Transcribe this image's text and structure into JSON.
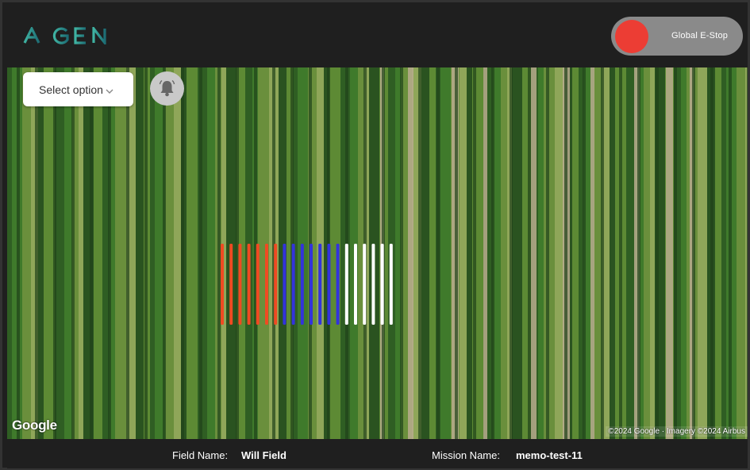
{
  "header": {
    "logo_text": "AIGEN",
    "estop_label": "Global E-Stop",
    "estop_color": "#ec3d34"
  },
  "map": {
    "select": {
      "label": "Select option",
      "icon": "chevron-down-icon"
    },
    "alerts_icon": "bell-icon",
    "google_logo": "Google",
    "attribution": "©2024 Google · Imagery ©2024 Airbus",
    "row_markers": {
      "colors": [
        "#f04a22",
        "#3333dd",
        "#ffffff"
      ],
      "counts": [
        7,
        7,
        6
      ]
    }
  },
  "footer": {
    "field_name_label": "Field Name:",
    "field_name_value": "Will Field",
    "mission_name_label": "Mission Name:",
    "mission_name_value": "memo-test-11"
  }
}
